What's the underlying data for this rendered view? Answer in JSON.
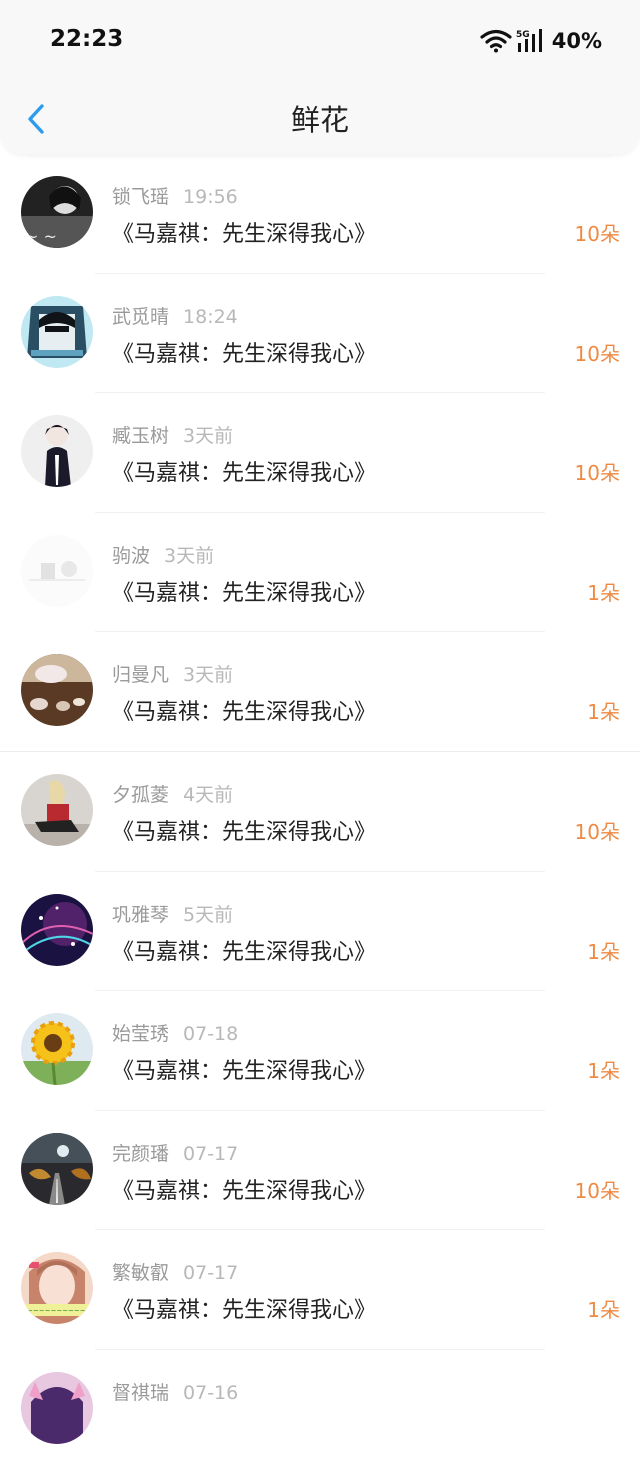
{
  "status_bar": {
    "time": "22:23",
    "battery": "40%",
    "network": "5G"
  },
  "header": {
    "title": "鲜花",
    "back_icon": "chevron-left-icon"
  },
  "colors": {
    "accent_count": "#ee8a44",
    "back_arrow": "#2d9cef"
  },
  "items": [
    {
      "name": "锁飞瑶",
      "time": "19:56",
      "book": "《马嘉祺：先生深得我心》",
      "count": "10朵"
    },
    {
      "name": "武觅晴",
      "time": "18:24",
      "book": "《马嘉祺：先生深得我心》",
      "count": "10朵"
    },
    {
      "name": "臧玉树",
      "time": "3天前",
      "book": "《马嘉祺：先生深得我心》",
      "count": "10朵"
    },
    {
      "name": "驹波",
      "time": "3天前",
      "book": "《马嘉祺：先生深得我心》",
      "count": "1朵"
    },
    {
      "name": "归曼凡",
      "time": "3天前",
      "book": "《马嘉祺：先生深得我心》",
      "count": "1朵"
    },
    {
      "name": "夕孤菱",
      "time": "4天前",
      "book": "《马嘉祺：先生深得我心》",
      "count": "10朵"
    },
    {
      "name": "巩雅琴",
      "time": "5天前",
      "book": "《马嘉祺：先生深得我心》",
      "count": "1朵"
    },
    {
      "name": "始莹琇",
      "time": "07-18",
      "book": "《马嘉祺：先生深得我心》",
      "count": "1朵"
    },
    {
      "name": "完颜璠",
      "time": "07-17",
      "book": "《马嘉祺：先生深得我心》",
      "count": "10朵"
    },
    {
      "name": "繁敏叡",
      "time": "07-17",
      "book": "《马嘉祺：先生深得我心》",
      "count": "1朵"
    },
    {
      "name": "督祺瑞",
      "time": "07-16",
      "book": "",
      "count": ""
    }
  ]
}
